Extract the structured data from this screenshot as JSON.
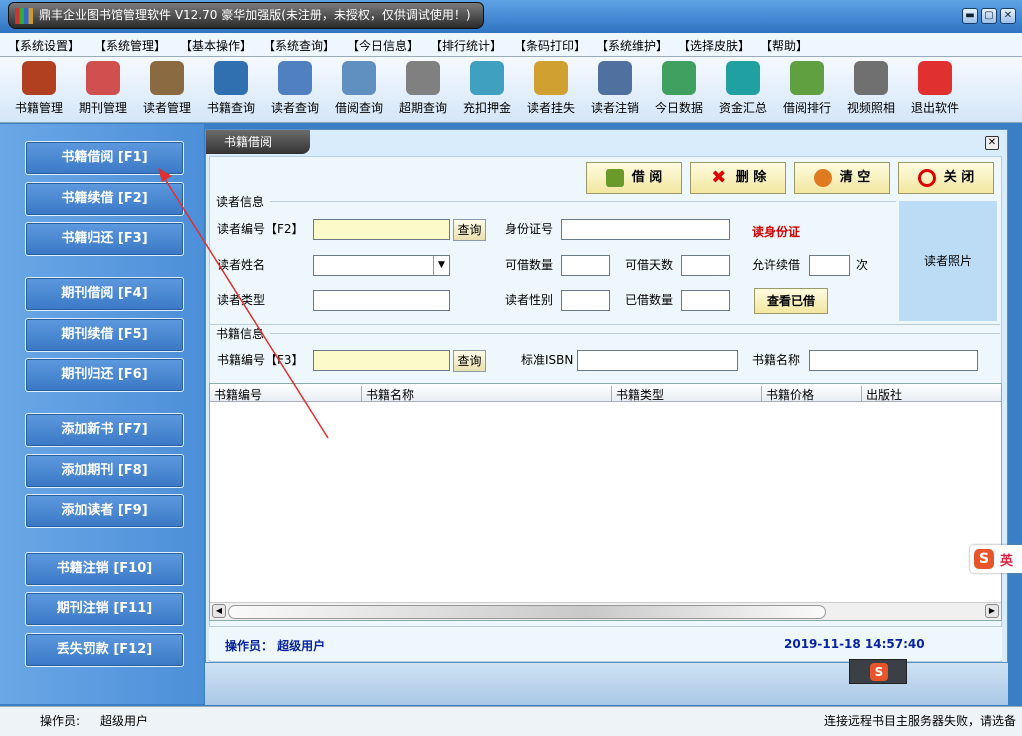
{
  "window": {
    "title": "鼎丰企业图书馆管理软件 V12.70 豪华加强版(未注册，未授权，仅供调试使用！)",
    "min": "▬",
    "max": "▢",
    "close": "✕"
  },
  "menu": [
    "【系统设置】",
    "【系统管理】",
    "【基本操作】",
    "【系统查询】",
    "【今日信息】",
    "【排行统计】",
    "【条码打印】",
    "【系统维护】",
    "【选择皮肤】",
    "【帮助】"
  ],
  "toolbar": [
    {
      "label": "书籍管理",
      "icon": "books-icon",
      "color": "#b04020"
    },
    {
      "label": "期刊管理",
      "icon": "magazine-icon",
      "color": "#d05050"
    },
    {
      "label": "读者管理",
      "icon": "reader-icon",
      "color": "#8a6a40"
    },
    {
      "label": "书籍查询",
      "icon": "book-search-icon",
      "color": "#3070b0"
    },
    {
      "label": "读者查询",
      "icon": "reader-search-icon",
      "color": "#5080c0"
    },
    {
      "label": "借阅查询",
      "icon": "borrow-search-icon",
      "color": "#6090c0"
    },
    {
      "label": "超期查询",
      "icon": "clock-icon",
      "color": "#808080"
    },
    {
      "label": "充扣押金",
      "icon": "deposit-icon",
      "color": "#40a0c0"
    },
    {
      "label": "读者挂失",
      "icon": "report-loss-icon",
      "color": "#d0a030"
    },
    {
      "label": "读者注销",
      "icon": "reader-cancel-icon",
      "color": "#5070a0"
    },
    {
      "label": "今日数据",
      "icon": "today-data-icon",
      "color": "#40a060"
    },
    {
      "label": "资金汇总",
      "icon": "yen-icon",
      "color": "#20a0a0"
    },
    {
      "label": "借阅排行",
      "icon": "ranking-icon",
      "color": "#60a040"
    },
    {
      "label": "视频照相",
      "icon": "camera-icon",
      "color": "#707070"
    },
    {
      "label": "退出软件",
      "icon": "exit-icon",
      "color": "#e03030"
    }
  ],
  "nav": [
    "书籍借阅 [F1]",
    "书籍续借 [F2]",
    "书籍归还 [F3]",
    "期刊借阅 [F4]",
    "期刊续借 [F5]",
    "期刊归还 [F6]",
    "添加新书 [F7]",
    "添加期刊 [F8]",
    "添加读者 [F9]",
    "书籍注销 [F10]",
    "期刊注销 [F11]",
    "丢失罚款 [F12]"
  ],
  "frame": {
    "tab": "书籍借阅",
    "close": "✕"
  },
  "actions": {
    "borrow": "借 阅",
    "delete": "删 除",
    "clear": "清 空",
    "close": "关 闭"
  },
  "reader": {
    "group": "读者信息",
    "id_label": "读者编号【F2】",
    "query": "查询",
    "idcard_label": "身份证号",
    "read_id": "读身份证",
    "name_label": "读者姓名",
    "can_borrow_qty": "可借数量",
    "can_borrow_days": "可借天数",
    "renew_allowed": "允许续借",
    "times": "次",
    "type_label": "读者类型",
    "gender_label": "读者性别",
    "borrowed_qty": "已借数量",
    "view_borrowed": "查看已借",
    "photo": "读者照片"
  },
  "book": {
    "group": "书籍信息",
    "id_label": "书籍编号【F3】",
    "query": "查询",
    "isbn_label": "标准ISBN",
    "name_label": "书籍名称"
  },
  "table": {
    "columns": [
      "书籍编号",
      "书籍名称",
      "书籍类型",
      "书籍价格",
      "出版社"
    ]
  },
  "inner_status": {
    "operator": "操作员： 超级用户",
    "datetime": "2019-11-18  14:57:40"
  },
  "status": {
    "operator_label": "操作员:",
    "operator": "超级用户",
    "message": "连接远程书目主服务器失败，请选备"
  },
  "ime": {
    "brand": "S",
    "lang": "英"
  }
}
